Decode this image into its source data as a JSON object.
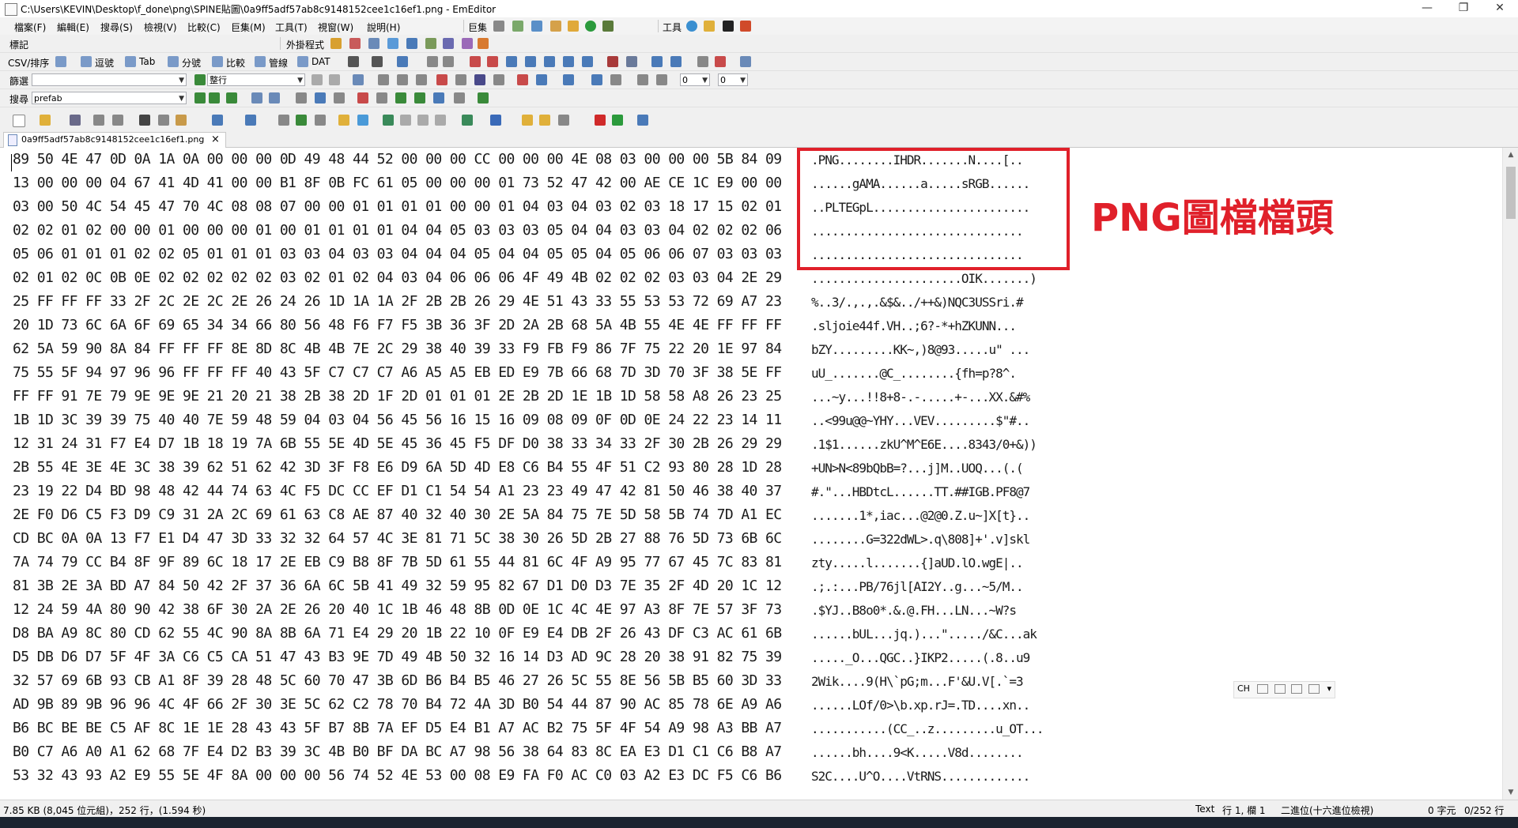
{
  "window": {
    "title": "C:\\Users\\KEVIN\\Desktop\\f_done\\png\\SPINE貼圖\\0a9ff5adf57ab8c9148152cee1c16ef1.png - EmEditor",
    "minimize": "—",
    "restore": "❐",
    "close": "✕"
  },
  "menu": [
    "檔案(F)",
    "編輯(E)",
    "搜尋(S)",
    "檢視(V)",
    "比較(C)",
    "巨集(M)",
    "工具(T)",
    "視窗(W)",
    "說明(H)"
  ],
  "menu_right": {
    "macros": "巨集",
    "tools": "工具"
  },
  "toolbar1": {
    "label": "標記",
    "plugins_label": "外掛程式"
  },
  "toolbar2": {
    "items": [
      "CSV/排序",
      "逗號",
      "Tab",
      "分號",
      "比較",
      "管線",
      "DAT"
    ]
  },
  "filterbar": {
    "label": "篩選",
    "value": "",
    "mode": "整行",
    "num1": "0",
    "num2": "0"
  },
  "searchbar": {
    "label": "搜尋",
    "value": "prefab"
  },
  "tab": {
    "filename": "0a9ff5adf57ab8c9148152cee1c16ef1.png",
    "close": "×"
  },
  "hex_rows": [
    "89 50 4E 47 0D 0A 1A 0A  00 00 00 0D 49 48 44 52  00 00 00 CC 00 00 00 4E  08 03 00 00 00 5B 84 09",
    "13 00 00 00 04 67 41 4D  41 00 00 B1 8F 0B FC 61  05 00 00 00 01 73 52 47  42 00 AE CE 1C E9 00 00",
    "03 00 50 4C 54 45 47 70  4C 08 08 07 00 00 01 01  01 01 00 00 01 04 03 04  03 02 03 18 17 15 02 01",
    "02 02 01 02 00 00 01 00  00 00 01 00 01 01 01 01  04 04 05 03 03 03 05 04  04 03 03 04 02 02 02 06",
    "05 06 01 01 01 02 02 05  01 01 01 03 03 04 03 03  04 04 04 05 04 04 05 05  04 05 06 06 07 03 03 03",
    "02 01 02 0C 0B 0E 02 02  02 02 02 03 02 01 02 04  03 04 06 06 06 4F 49 4B  02 02 02 03 03 04 2E 29",
    "25 FF FF FF 33 2F 2C 2E  2C 2E 26 24 26 1D 1A 1A  2F 2B 2B 26 29 4E 51 43  33 55 53 53 72 69 A7 23",
    "20 1D 73 6C 6A 6F 69 65  34 34 66 80 56 48 F6 F7  F5 3B 36 3F 2D 2A 2B 68  5A 4B 55 4E 4E FF FF FF",
    "62 5A 59 90 8A 84 FF FF  FF 8E 8D 8C 4B 4B 7E 2C  29 38 40 39 33 F9 FB F9  86 7F 75 22 20 1E 97 84",
    "75 55 5F 94 97 96 96 FF  FF FF 40 43 5F C7 C7 C7  A6 A5 A5 EB ED E9 7B 66  68 7D 3D 70 3F 38 5E FF",
    "FF FF 91 7E 79 9E 9E 9E  21 20 21 38 2B 38 2D 1F  2D 01 01 01 2E 2B 2D 1E  1B 1D 58 58 A8 26 23 25",
    "1B 1D 3C 39 39 75 40 40  7E 59 48 59 04 03 04 56  45 56 16 15 16 09 08 09  0F 0D 0E 24 22 23 14 11",
    "12 31 24 31 F7 E4 D7 1B  18 19 7A 6B 55 5E 4D 5E  45 36 45 F5 DF D0 38 33  34 33 2F 30 2B 26 29 29",
    "2B 55 4E 3E 4E 3C 38 39  62 51 62 42 3D 3F F8 E6  D9 6A 5D 4D E8 C6 B4 55  4F 51 C2 93 80 28 1D 28",
    "23 19 22 D4 BD 98 48 42  44 74 63 4C F5 DC CC EF  D1 C1 54 54 A1 23 23 49  47 42 81 50 46 38 40 37",
    "2E F0 D6 C5 F3 D9 C9 31  2A 2C 69 61 63 C8 AE 87  40 32 40 30 2E 5A 84 75  7E 5D 58 5B 74 7D A1 EC",
    "CD BC 0A 0A 13 F7 E1 D4  47 3D 33 32 32 64 57 4C  3E 81 71 5C 38 30 26 5D  2B 27 88 76 5D 73 6B 6C",
    "7A 74 79 CC B4 8F 9F 89  6C 18 17 2E EB C9 B8 8F  7B 5D 61 55 44 81 6C 4F  A9 95 77 67 45 7C 83 81",
    "81 3B 2E 3A BD A7 84 50  42 2F 37 36 6A 6C 5B 41  49 32 59 95 82 67 D1 D0  D3 7E 35 2F 4D 20 1C 12",
    "12 24 59 4A 80 90 42 38  6F 30 2A 2E 26 20 40 1C  1B 46 48 8B 0D 0E 1C 4C  4E 97 A3 8F 7E 57 3F 73",
    "D8 BA A9 8C 80 CD 62 55  4C 90 8A 8B 6A 71 E4 29  20 1B 22 10 0F E9 E4 DB  2F 26 43 DF C3 AC 61 6B",
    "D5 DB D6 D7 5F 4F 3A C6  C5 CA 51 47 43 B3 9E 7D  49 4B 50 32 16 14 D3 AD  9C 28 20 38 91 82 75 39",
    "32 57 69 6B 93 CB A1 8F  39 28 48 5C 60 70 47 3B  6D B6 B4 B5 46 27 26 5C  55 8E 56 5B B5 60 3D 33",
    "AD 9B 89 9B 96 96 4C 4F  66 2F 30 3E 5C 62 C2 78  70 B4 72 4A 3D B0 54 44  87 90 AC 85 78 6E A9 A6",
    "B6 BC BE BE C5 AF 8C 1E  1E 28 43 43 5F B7 8B 7A  EF D5 E4 B1 A7 AC B2 75  5F 4F 54 A9 98 A3 BB A7",
    "B0 C7 A6 A0 A1 62 68 7F  E4 D2 B3 39 3C 4B B0 BF  DA BC A7 98 56 38 64 83  8C EA E3 D1 C1 C6 B8 A7",
    "53 32 43 93 A2 E9 55 5E  4F 8A 00 00 00 56 74 52  4E 53 00 08 E9 FA F0 AC  C0 03 A2 E3 DC F5 C6 B6"
  ],
  "ascii_rows": [
    ".PNG........IHDR.......N....[..",
    "......gAMA......a.....sRGB......",
    "..PLTEGpL.......................",
    "...............................",
    "...............................",
    "......................OIK.......)",
    "%..3/.,.,.&$&../++&)NQC3USSri.#",
    ".sljoie44f.VH..;6?-*+hZKUNN...",
    "bZY.........KK~,)8@93.....u\" ...",
    "uU_.......@C_........{fh=p?8^.",
    "...~y...!!8+8-.-.....+-...XX.&#%",
    "..<99u@@~YHY...VEV.........$\"#..",
    ".1$1......zkU^M^E6E....8343/0+&))",
    "+UN>N<89bQbB=?...j]M..UOQ...(.(",
    "#.\"...HBDtcL......TT.##IGB.PF8@7",
    ".......1*,iac...@2@0.Z.u~]X[t}..",
    "........G=322dWL>.q\\808]+'.v]skl",
    "zty.....l.......{]aUD.lO.wgE|..",
    ".;.:...PB/76jl[AI2Y..g...~5/M..",
    ".$YJ..B8o0*.&.@.FH...LN...~W?s",
    "......bUL...jq.)...\"...../&C...ak",
    "....._O...QGC..}IKP2.....(.8..u9",
    "2Wik....9(H\\`pG;m...F'&U.V[.`=3",
    "......LOf/0>\\b.xp.rJ=.TD....xn..",
    "...........(CC_..z.........u_OT...",
    "......bh....9<K.....V8d........",
    "S2C....U^O....VtRNS............."
  ],
  "annotation": "PNG圖檔檔頭",
  "ime_bar": "CH",
  "status": {
    "left": "7.85 KB (8,045 位元組)，252 行，(1.594 秒)",
    "mode": "Text",
    "position": "行 1, 欄 1",
    "encoding": "二進位(十六進位檢視)",
    "chars": "0 字元",
    "lines": "0/252 行"
  }
}
